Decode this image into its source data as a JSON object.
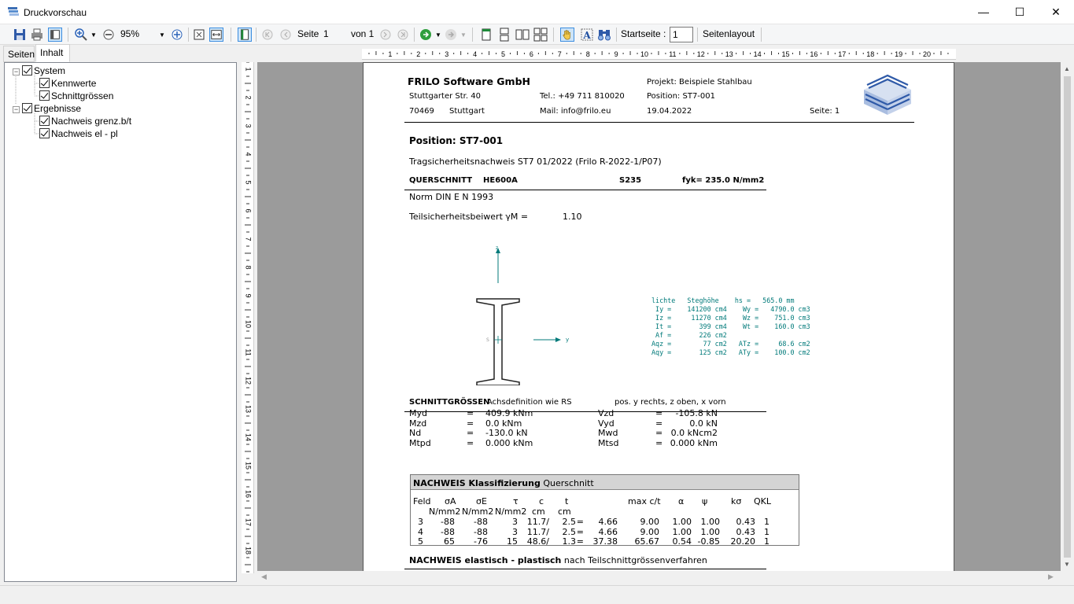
{
  "window": {
    "title": "Druckvorschau",
    "min": "—",
    "max": "☐",
    "close": "✕"
  },
  "toolbar": {
    "zoom_value": "95%",
    "page_label": "Seite",
    "page_value": "1",
    "of_label": "von 1",
    "startpage_label": "Startseite :",
    "startpage_value": "1",
    "layout_label": "Seitenlayout"
  },
  "tabs": [
    {
      "label": "Seiten"
    },
    {
      "label": "Inhalt"
    }
  ],
  "tree": {
    "system": "System",
    "kennwerte": "Kennwerte",
    "schnittgroessen": "Schnittgrössen",
    "ergebnisse": "Ergebnisse",
    "nachweis_grenz": "Nachweis grenz.b/t",
    "nachweis_el": "Nachweis el - pl"
  },
  "rulers": {
    "h": [
      "1",
      "2",
      "3",
      "4",
      "5",
      "6",
      "7",
      "8",
      "9",
      "10",
      "11",
      "12",
      "13",
      "14",
      "15",
      "16",
      "17",
      "18",
      "19",
      "20"
    ],
    "v": [
      "1",
      "2",
      "3",
      "4",
      "5",
      "6",
      "7",
      "8",
      "9",
      "10",
      "11",
      "12",
      "13",
      "14",
      "15",
      "16",
      "17",
      "18"
    ]
  },
  "doc": {
    "company": "FRILO Software GmbH",
    "street": "Stuttgarter Str. 40",
    "zip": "70469",
    "city": "Stuttgart",
    "tel": "Tel.: +49 711 810020",
    "mail": "Mail: info@frilo.eu",
    "projekt": "Projekt: Beispiele Stahlbau",
    "position_hdr": "Position: ST7-001",
    "date": "19.04.2022",
    "seite": "Seite: 1",
    "position_title": "Position: ST7-001",
    "subtitle": "Tragsicherheitsnachweis  ST7  01/2022 (Frilo R-2022-1/P07)",
    "qs_label": "QUERSCHNITT",
    "qs_profile": "HE600A",
    "qs_steel": "S235",
    "qs_fyk": "fyk= 235.0 N/mm2",
    "norm": "Norm DIN E   N 1993",
    "teilsich_label": "Teilsicherheitsbeiwert γM =",
    "teilsich_value": "1.10",
    "axis_z": "z",
    "axis_y": "y",
    "axis_s": "S",
    "props": [
      "lichte   Steghöhe    hs =   565.0 mm",
      " Iy =    141200 cm4    Wy =   4790.0 cm3",
      " Iz =     11270 cm4    Wz =    751.0 cm3",
      " It =       399 cm4    Wt =    160.0 cm3",
      " Af =       226 cm2",
      "Aqz =        77 cm2   ATz =     68.6 cm2",
      "Aqy =       125 cm2   ATy =    100.0 cm2"
    ],
    "sg_title": "SCHNITTGRÖSSEN",
    "sg_axis": "Achsdefinition wie RS",
    "sg_pos": "pos. y rechts, z oben, x vorn",
    "sg_rows": [
      {
        "l1": "Myd",
        "v1": "409.9 kNm",
        "l2": "Vzd",
        "v2": "-105.8 kN"
      },
      {
        "l1": "Mzd",
        "v1": "0.0 kNm",
        "l2": "Vyd",
        "v2": "0.0 kN"
      },
      {
        "l1": "Nd",
        "v1": "-130.0 kN",
        "l2": "Mwd",
        "v2": "0.0 kNcm2"
      },
      {
        "l1": "Mtpd",
        "v1": "0.000 kNm",
        "l2": "Mtsd",
        "v2": "0.000 kNm"
      }
    ],
    "sg_eq": "=",
    "kl_title_bold": "NACHWEIS Klassifizierung",
    "kl_title_rest": "Querschnitt",
    "kl_headers": [
      "Feld",
      "σA",
      "σE",
      "τ",
      "c",
      "t",
      "max c/t",
      "α",
      "ψ",
      "kσ",
      "QKL"
    ],
    "kl_units": [
      "N/mm2",
      "N/mm2",
      "N/mm2",
      "cm",
      "cm"
    ],
    "kl_rows": [
      [
        "3",
        "-88",
        "-88",
        "3",
        "11.7/",
        "2.5",
        "=",
        "4.66",
        "9.00",
        "1.00",
        "1.00",
        "0.43",
        "1"
      ],
      [
        "4",
        "-88",
        "-88",
        "3",
        "11.7/",
        "2.5",
        "=",
        "4.66",
        "9.00",
        "1.00",
        "1.00",
        "0.43",
        "1"
      ],
      [
        "5",
        "65",
        "-76",
        "15",
        "48.6/",
        "1.3",
        "=",
        "37.38",
        "65.67",
        "0.54",
        "-0.85",
        "20.20",
        "1"
      ]
    ],
    "el_title_bold": "NACHWEIS elastisch - plastisch",
    "el_title_rest": "nach Teilschnittgrössenverfahren"
  },
  "colors": {
    "accent": "#1f6fb2",
    "teal": "#007a7a",
    "page_bg": "#9b9b9b"
  }
}
